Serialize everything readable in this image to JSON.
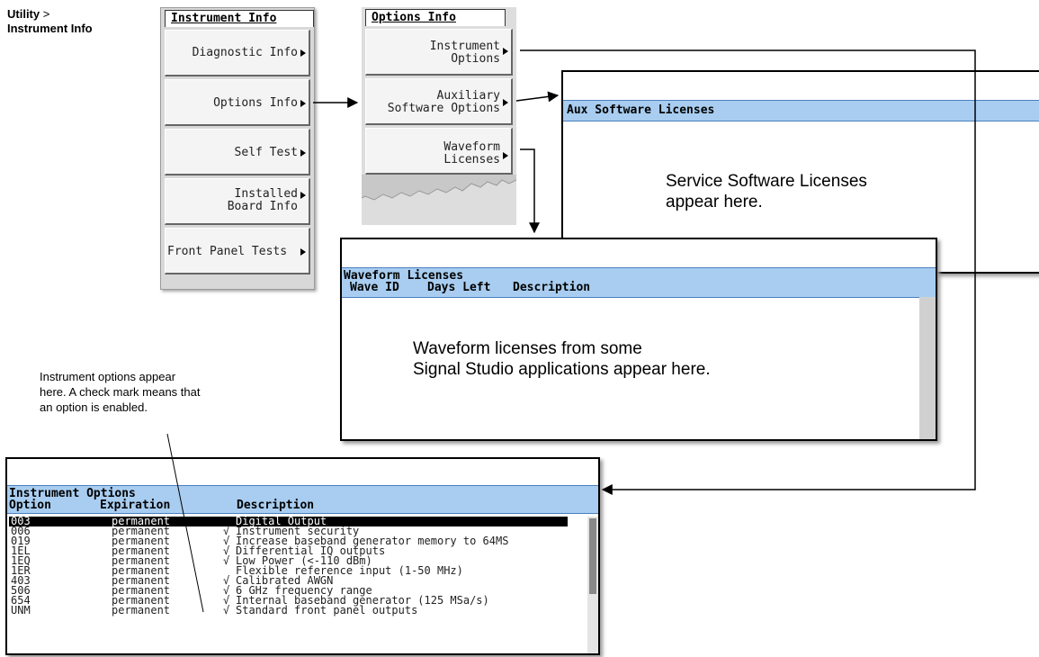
{
  "breadcrumb": {
    "parent": "Utility",
    "separator": ">",
    "current": "Instrument Info"
  },
  "instrument_info_menu": {
    "title": "Instrument Info",
    "keys": [
      {
        "label1": "",
        "label2": "Diagnostic Info"
      },
      {
        "label1": "",
        "label2": "Options Info"
      },
      {
        "label1": "",
        "label2": "Self Test"
      },
      {
        "label1": "Installed",
        "label2": "Board Info"
      },
      {
        "label1": "",
        "label2": "Front Panel Tests"
      }
    ]
  },
  "options_info_menu": {
    "title": "Options Info",
    "keys": [
      {
        "label1": "Instrument",
        "label2": "Options"
      },
      {
        "label1": "Auxiliary",
        "label2": "Software Options"
      },
      {
        "label1": "Waveform",
        "label2": "Licenses"
      }
    ]
  },
  "aux_window": {
    "header": "Aux Software Licenses",
    "message_line1": "Service Software Licenses",
    "message_line2": "appear here."
  },
  "waveform_window": {
    "header": "Waveform Licenses",
    "columns": {
      "id": "Wave ID",
      "days": "Days Left",
      "desc": "Description"
    },
    "message_line1": "Waveform licenses from some",
    "message_line2": "Signal Studio applications appear here."
  },
  "options_window": {
    "header": "Instrument Options",
    "columns": {
      "option": "Option",
      "expiration": "Expiration",
      "description": "Description"
    },
    "rows": [
      {
        "option": "003",
        "expiration": "permanent",
        "check": "",
        "description": "Digital Output",
        "selected": true
      },
      {
        "option": "006",
        "expiration": "permanent",
        "check": "√",
        "description": "Instrument security"
      },
      {
        "option": "019",
        "expiration": "permanent",
        "check": "√",
        "description": "Increase baseband generator memory to 64MS"
      },
      {
        "option": "1EL",
        "expiration": "permanent",
        "check": "√",
        "description": "Differential IQ outputs"
      },
      {
        "option": "1EQ",
        "expiration": "permanent",
        "check": "√",
        "description": "Low Power (<-110 dBm)"
      },
      {
        "option": "1ER",
        "expiration": "permanent",
        "check": "",
        "description": "Flexible reference input (1-50 MHz)"
      },
      {
        "option": "403",
        "expiration": "permanent",
        "check": "√",
        "description": "Calibrated AWGN"
      },
      {
        "option": "506",
        "expiration": "permanent",
        "check": "√",
        "description": "6 GHz frequency range"
      },
      {
        "option": "654",
        "expiration": "permanent",
        "check": "√",
        "description": "Internal baseband generator (125 MSa/s)"
      },
      {
        "option": "UNM",
        "expiration": "permanent",
        "check": "√",
        "description": "Standard front panel outputs"
      }
    ]
  },
  "annotation": {
    "line1": "Instrument options appear",
    "line2": "here. A check mark means that",
    "line3": "an option is enabled."
  },
  "colors": {
    "header_bar": "#a8cdf0",
    "panel": "#d8d8d8"
  }
}
